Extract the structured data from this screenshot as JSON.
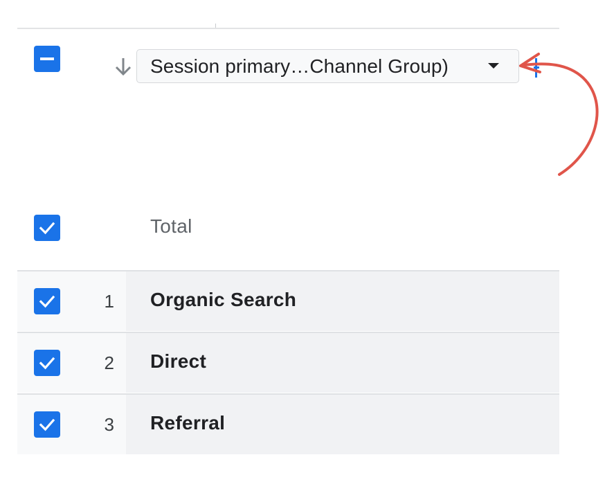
{
  "header": {
    "dimension_select": {
      "selected": "Session primary…Channel Group)"
    }
  },
  "total": {
    "label": "Total"
  },
  "rows": [
    {
      "index": "1",
      "label": "Organic Search"
    },
    {
      "index": "2",
      "label": "Direct"
    },
    {
      "index": "3",
      "label": "Referral"
    }
  ],
  "colors": {
    "accent_blue": "#1a73e8",
    "annotation_red": "#e0554a",
    "row_background": "#f1f2f4"
  },
  "icons": {
    "header_checkbox": "minus-checkbox-icon",
    "row_checkbox": "check-checkbox-icon",
    "sort": "arrow-down-icon",
    "dropdown": "caret-down-icon"
  }
}
